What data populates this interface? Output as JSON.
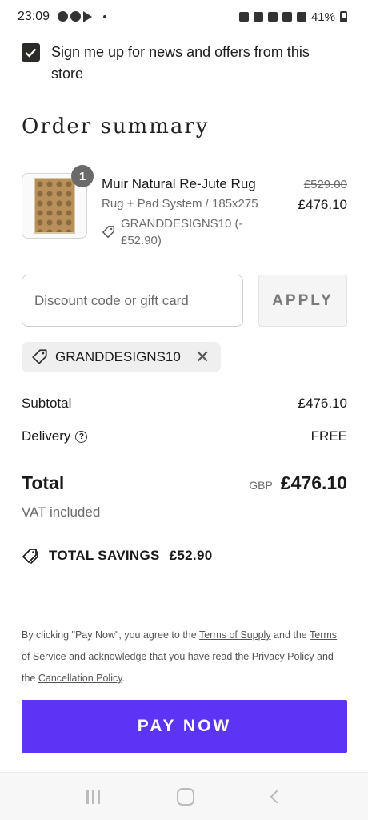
{
  "status_bar": {
    "time": "23:09",
    "battery": "41%"
  },
  "newsletter": {
    "checked": true,
    "label": "Sign me up for news and offers from this store"
  },
  "order_summary": {
    "title": "Order summary",
    "product": {
      "quantity": "1",
      "name": "Muir Natural Re-Jute Rug",
      "variant": "Rug + Pad System / 185x275",
      "discount_applied": "GRANDDESIGNS10 (-£52.90)",
      "original_price": "£529.00",
      "price": "£476.10"
    },
    "discount": {
      "placeholder": "Discount code or gift card",
      "apply_label": "APPLY",
      "applied_code": "GRANDDESIGNS10"
    },
    "subtotal": {
      "label": "Subtotal",
      "value": "£476.10"
    },
    "delivery": {
      "label": "Delivery",
      "value": "FREE"
    },
    "total": {
      "label": "Total",
      "currency": "GBP",
      "value": "£476.10"
    },
    "vat": "VAT included",
    "savings": {
      "label": "TOTAL SAVINGS",
      "value": "£52.90"
    }
  },
  "legal": {
    "t1": "By clicking \"Pay Now\", you agree to the ",
    "link1": "Terms of Supply",
    "t2": " and the ",
    "link2": "Terms of Service",
    "t3": " and acknowledge that you have read the ",
    "link3": "Privacy Policy",
    "t4": " and the ",
    "link4": "Cancellation Policy",
    "t5": "."
  },
  "pay_button": "PAY NOW",
  "colors": {
    "accent": "#5c34f5",
    "checkbox": "#2b2b27"
  }
}
